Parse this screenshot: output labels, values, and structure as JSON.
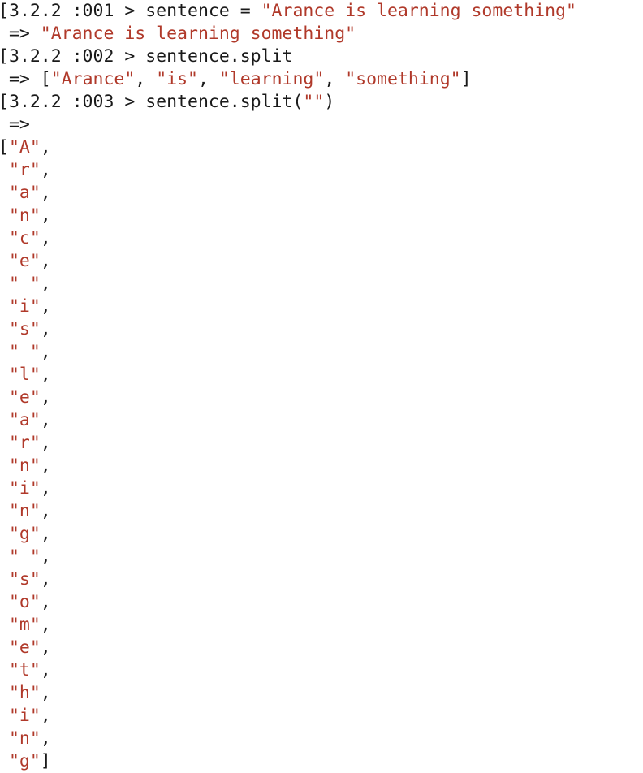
{
  "terminal": {
    "app": "irb",
    "language": "Ruby",
    "ruby_version": "3.2.2",
    "background_color": "#ffffff",
    "text_color": "#1a1a1a",
    "string_color": "#b0392a",
    "prompt_template": "[3.2.2 :NNN > ",
    "result_marker": "=>",
    "lines": [
      {
        "kind": "input",
        "prompt": "[3.2.2 :001 > ",
        "code_plain_before": "sentence = ",
        "code_string": "\"Arance is learning something\"",
        "code_plain_after": ""
      },
      {
        "kind": "output",
        "marker": " => ",
        "value_string": "\"Arance is learning something\"",
        "value_plain_after": ""
      },
      {
        "kind": "input",
        "prompt": "[3.2.2 :002 > ",
        "code_plain_before": "sentence.split",
        "code_string": "",
        "code_plain_after": ""
      },
      {
        "kind": "output-array",
        "marker": " => ",
        "open_bracket": "[",
        "items": [
          "\"Arance\"",
          "\"is\"",
          "\"learning\"",
          "\"something\""
        ],
        "separator": ", ",
        "close_bracket": "]"
      },
      {
        "kind": "input",
        "prompt": "[3.2.2 :003 > ",
        "code_plain_before": "sentence.split(",
        "code_string": "\"\"",
        "code_plain_after": ")"
      },
      {
        "kind": "output",
        "marker": " =>",
        "value_string": "",
        "value_plain_after": ""
      }
    ],
    "char_array": {
      "open_bracket": "[",
      "close_bracket": "]",
      "comma": ",",
      "indent": " ",
      "items": [
        "\"A\"",
        "\"r\"",
        "\"a\"",
        "\"n\"",
        "\"c\"",
        "\"e\"",
        "\" \"",
        "\"i\"",
        "\"s\"",
        "\" \"",
        "\"l\"",
        "\"e\"",
        "\"a\"",
        "\"r\"",
        "\"n\"",
        "\"i\"",
        "\"n\"",
        "\"g\"",
        "\" \"",
        "\"s\"",
        "\"o\"",
        "\"m\"",
        "\"e\"",
        "\"t\"",
        "\"h\"",
        "\"i\"",
        "\"n\"",
        "\"g\""
      ]
    }
  }
}
